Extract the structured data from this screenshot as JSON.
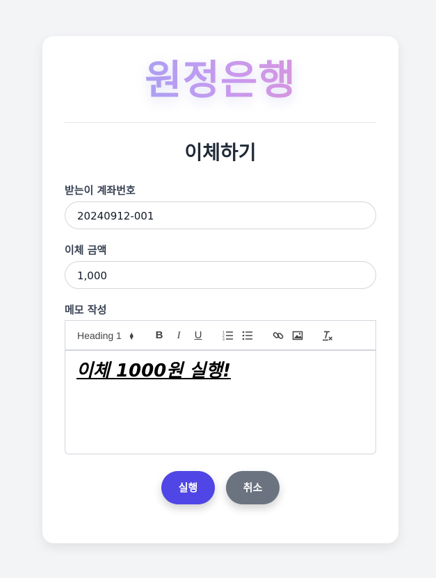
{
  "header": {
    "logo_text": "원정은행"
  },
  "page": {
    "title": "이체하기"
  },
  "form": {
    "account_label": "받는이 계좌번호",
    "account_value": "20240912-001",
    "amount_label": "이체 금액",
    "amount_value": "1,000",
    "memo_label": "메모 작성"
  },
  "editor": {
    "heading_select": "Heading 1",
    "toolbar_icons": [
      "bold-icon",
      "italic-icon",
      "underline-icon",
      "ordered-list-icon",
      "bullet-list-icon",
      "link-icon",
      "image-icon",
      "clear-format-icon"
    ],
    "content": "이체 1000원 실행!"
  },
  "actions": {
    "submit_label": "실행",
    "cancel_label": "취소"
  },
  "colors": {
    "primary": "#4f46e5",
    "secondary": "#6b7280",
    "background": "#f3f4f6"
  }
}
